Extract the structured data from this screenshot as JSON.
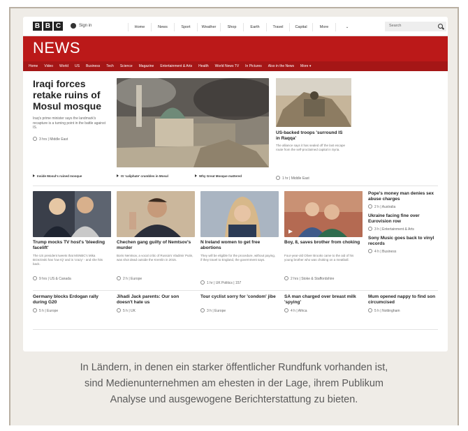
{
  "top_bar": {
    "logo_letters": [
      "B",
      "B",
      "C"
    ],
    "sign_in": "Sign in",
    "nav": [
      "Home",
      "News",
      "Sport",
      "Weather",
      "Shop",
      "Earth",
      "Travel",
      "Capital",
      "More"
    ],
    "more_toggle": "⌄",
    "search_placeholder": "Search"
  },
  "news_header": {
    "logo": "NEWS",
    "sections": [
      "Home",
      "Video",
      "World",
      "US",
      "Business",
      "Tech",
      "Science",
      "Magazine",
      "Entertainment & Arts",
      "Health",
      "World News TV",
      "In Pictures",
      "Also in the News",
      "More ▾"
    ]
  },
  "lead": {
    "title": "Iraqi forces retake ruins of Mosul mosque",
    "summary": "Iraq's prime minister says the landmark's recapture is a turning point in the battle against IS.",
    "time": "3 hrs",
    "section": "Middle East",
    "related": [
      "Inside Mosul's ruined mosque",
      "IS 'caliphate' crumbles in Mosul",
      "Why Great Mosque mattered"
    ]
  },
  "second": {
    "title": "US-backed troops 'surround IS in Raqqa'",
    "summary": "The alliance says it has sealed off the last escape route from the self-proclaimed capital in Syria.",
    "time": "1 hr",
    "section": "Middle East"
  },
  "row1": [
    {
      "title": "Trump mocks TV host's 'bleeding facelift'",
      "summary": "The US president tweets that MSNBC's Mika Brzezinski has 'low IQ' and is 'crazy' - and she hits back.",
      "time": "9 hrs",
      "section": "US & Canada"
    },
    {
      "title": "Chechen gang guilty of Nemtsov's murder",
      "summary": "Boris Nemtsov, a vocal critic of Russia's Vladimir Putin, was shot dead outside the Kremlin in 2015.",
      "time": "2 h",
      "section": "Europe"
    },
    {
      "title": "N Ireland women to get free abortions",
      "summary": "They will be eligible for the procedure, without paying, if they travel to England, the government says.",
      "time": "1 hr",
      "section": "UK Politics",
      "count": "157"
    },
    {
      "title": "Boy, 8, saves brother from choking",
      "summary": "Four-year-old Oliver Brooks came to the aid of his young brother who was choking on a meatball.",
      "time": "2 hrs",
      "section": "Stoke & Staffordshire"
    }
  ],
  "side_list": [
    {
      "title": "Pope's money man denies sex abuse charges",
      "time": "2 h",
      "section": "Australia"
    },
    {
      "title": "Ukraine facing fine over Eurovision row",
      "time": "3 h",
      "section": "Entertainment & Arts"
    },
    {
      "title": "Sony Music goes back to vinyl records",
      "time": "4 h",
      "section": "Business"
    }
  ],
  "row2": [
    {
      "title": "Germany blocks Erdogan rally during G20",
      "time": "5 h",
      "section": "Europe"
    },
    {
      "title": "Jihadi Jack parents: Our son doesn't hate us",
      "time": "5 h",
      "section": "UK"
    },
    {
      "title": "Tour cyclist sorry for 'condom' jibe",
      "time": "3 h",
      "section": "Europe"
    },
    {
      "title": "SA man charged over breast milk 'spying'",
      "time": "4 h",
      "section": "Africa"
    },
    {
      "title": "Mum opened nappy to find son circumcised",
      "time": "5 h",
      "section": "Nottingham"
    }
  ],
  "caption": {
    "lines": [
      "In Ländern, in denen ein starker öffentlicher Rundfunk vorhanden ist,",
      "sind Medienunternehmen am ehesten in der Lage, ihrem Publikum",
      "Analyse und ausgewogene Berichterstattung zu bieten."
    ]
  }
}
